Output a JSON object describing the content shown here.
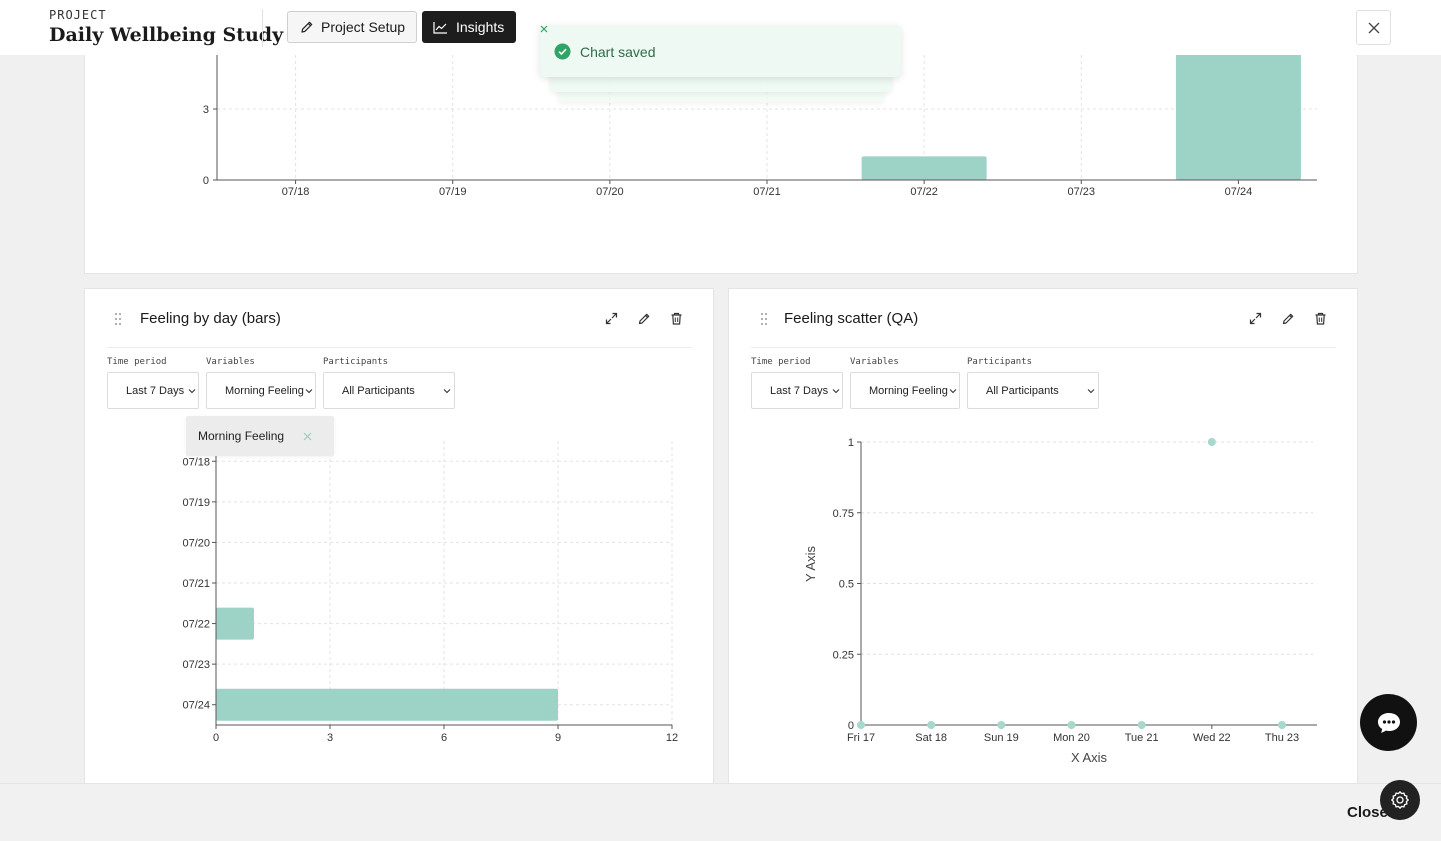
{
  "header": {
    "project_label": "PROJECT",
    "project_title": "Daily Wellbeing Study",
    "setup_label": "Project Setup",
    "insights_label": "Insights"
  },
  "toast": {
    "message": "Chart saved"
  },
  "cards": {
    "top": {},
    "bars": {
      "title": "Feeling by day (bars)",
      "time_period_label": "Time period",
      "time_period_value": "Last 7 Days",
      "variables_label": "Variables",
      "variables_value": "Morning Feeling",
      "participants_label": "Participants",
      "participants_value": "All Participants",
      "popover_text": "Morning Feeling"
    },
    "scatter": {
      "title": "Feeling scatter (QA)",
      "time_period_label": "Time period",
      "time_period_value": "Last 7 Days",
      "variables_label": "Variables",
      "variables_value": "Morning Feeling",
      "participants_label": "Participants",
      "participants_value": "All Participants"
    }
  },
  "footer": {
    "close_label": "Close"
  },
  "colors": {
    "bar": "#9dd2c6",
    "point": "#a6d8cb",
    "toast_bg": "#edf9f2",
    "toast_check": "#2ea567"
  },
  "chart_data": [
    {
      "type": "bar",
      "categories": [
        "07/18",
        "07/19",
        "07/20",
        "07/21",
        "07/22",
        "07/23",
        "07/24"
      ],
      "values": [
        0,
        0,
        0,
        0,
        1,
        0,
        9
      ],
      "y_ticks": [
        0,
        3
      ],
      "grid": true
    },
    {
      "type": "bar",
      "orientation": "horizontal",
      "title": "Feeling by day (bars)",
      "categories": [
        "07/18",
        "07/19",
        "07/20",
        "07/21",
        "07/22",
        "07/23",
        "07/24"
      ],
      "values": [
        0,
        0,
        0,
        0,
        1,
        0,
        9
      ],
      "x_ticks": [
        0,
        3,
        6,
        9,
        12
      ],
      "xlim": [
        0,
        12
      ],
      "grid": true
    },
    {
      "type": "scatter",
      "title": "Feeling scatter (QA)",
      "xlabel": "X Axis",
      "ylabel": "Y Axis",
      "categories": [
        "Fri 17",
        "Sat 18",
        "Sun 19",
        "Mon 20",
        "Tue 21",
        "Wed 22",
        "Thu 23"
      ],
      "values": [
        0,
        0,
        0,
        0,
        0,
        1,
        0
      ],
      "y_ticks": [
        0,
        0.25,
        0.5,
        0.75,
        1
      ],
      "ylim": [
        0,
        1
      ],
      "grid": true
    }
  ]
}
